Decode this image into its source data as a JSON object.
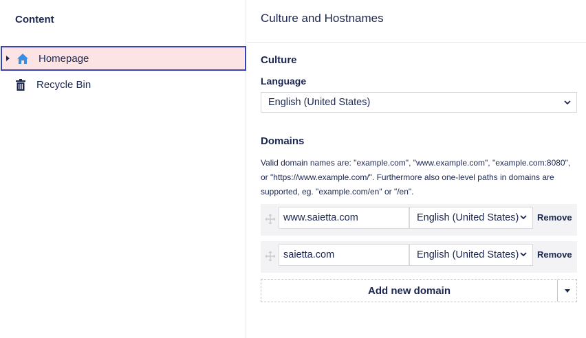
{
  "tree": {
    "title": "Content",
    "items": [
      {
        "label": "Homepage",
        "icon": "home-icon",
        "selected": true
      },
      {
        "label": "Recycle Bin",
        "icon": "trash-icon",
        "selected": false
      }
    ]
  },
  "panel": {
    "title": "Culture and Hostnames",
    "culture": {
      "heading": "Culture",
      "language_label": "Language",
      "language_value": "English (United States)"
    },
    "domains": {
      "heading": "Domains",
      "help": "Valid domain names are: \"example.com\", \"www.example.com\", \"example.com:8080\", or \"https://www.example.com/\". Furthermore also one-level paths in domains are supported, eg. \"example.com/en\" or \"/en\".",
      "rows": [
        {
          "hostname": "www.saietta.com",
          "language": "English (United States)",
          "remove_label": "Remove"
        },
        {
          "hostname": "saietta.com",
          "language": "English (United States)",
          "remove_label": "Remove"
        }
      ],
      "add_label": "Add new domain"
    }
  },
  "colors": {
    "text": "#1b264f",
    "selected_bg": "#fde4e4",
    "selected_border": "#3544b1",
    "home_icon": "#3b8de0",
    "row_bg": "#f3f3f5"
  }
}
